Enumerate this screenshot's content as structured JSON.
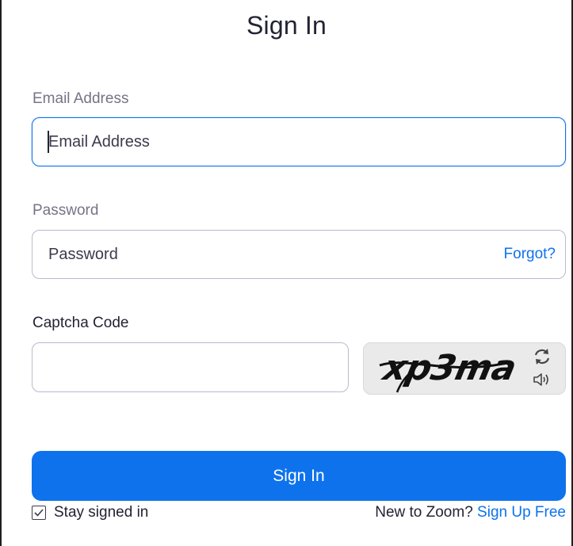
{
  "form": {
    "title": "Sign In",
    "email": {
      "label": "Email Address",
      "placeholder": "Email Address",
      "value": ""
    },
    "password": {
      "label": "Password",
      "placeholder": "Password",
      "value": "",
      "forgot_label": "Forgot?"
    },
    "captcha": {
      "label": "Captcha Code",
      "value": "",
      "image_text": "xp3ma",
      "refresh_icon": "refresh-icon",
      "audio_icon": "speaker-icon"
    },
    "submit_label": "Sign In",
    "stay_signed_in": {
      "label": "Stay signed in",
      "checked": true
    },
    "signup": {
      "prompt": "New to Zoom?",
      "link_label": "Sign Up Free"
    }
  },
  "colors": {
    "accent": "#0e72ed",
    "text": "#232333",
    "muted_label": "#747487",
    "border": "#babacc"
  }
}
